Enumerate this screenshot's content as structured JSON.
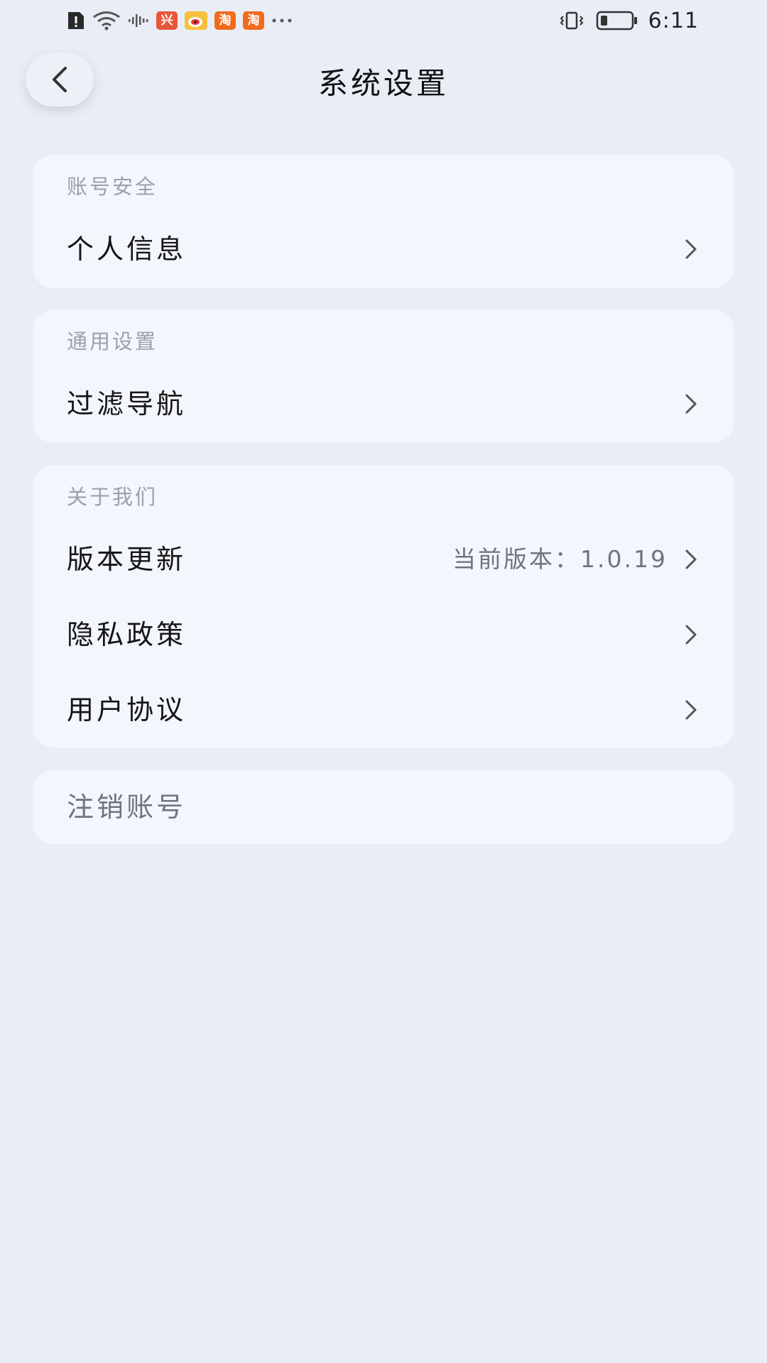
{
  "status_bar": {
    "time": "6:11",
    "left_icons": [
      "alert-icon",
      "wifi-icon",
      "audio-wave-icon",
      "app-icon-1",
      "weibo-icon",
      "taobao-icon-1",
      "taobao-icon-2",
      "more-dots-icon"
    ],
    "right_icons": [
      "vibrate-icon",
      "battery-icon"
    ],
    "app_badges": {
      "app1": "兴",
      "taobao1": "淘",
      "taobao2": "淘"
    }
  },
  "header": {
    "title": "系统设置",
    "back_icon": "chevron-left-icon"
  },
  "sections": {
    "account_security": {
      "header": "账号安全",
      "items": [
        {
          "label": "个人信息"
        }
      ]
    },
    "general_settings": {
      "header": "通用设置",
      "items": [
        {
          "label": "过滤导航"
        }
      ]
    },
    "about_us": {
      "header": "关于我们",
      "items": [
        {
          "label": "版本更新",
          "value": "当前版本：1.0.19"
        },
        {
          "label": "隐私政策"
        },
        {
          "label": "用户协议"
        }
      ]
    },
    "danger": {
      "items": [
        {
          "label": "注销账号"
        }
      ]
    }
  },
  "colors": {
    "background": "#e9edf5",
    "card": "#f3f6fc",
    "section_header": "#9aa0ad",
    "secondary_text": "#6f7480",
    "primary_text": "#151515"
  }
}
